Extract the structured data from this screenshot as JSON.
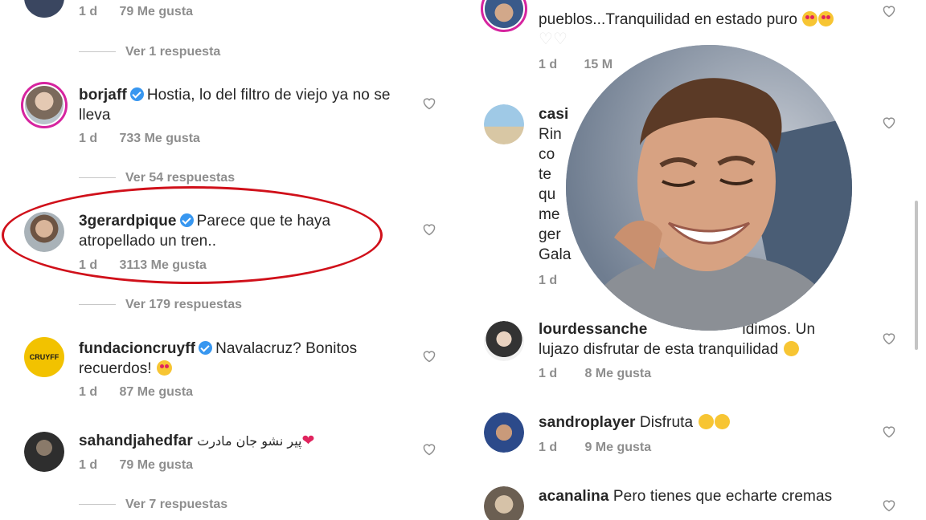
{
  "left_panel": {
    "top_comment": {
      "time": "1 d",
      "likes": "79 Me gusta",
      "replies": "Ver 1 respuesta"
    },
    "comments": [
      {
        "user": "borjaff",
        "verified": true,
        "text": "Hostia, lo del filtro de viejo ya no se lleva",
        "time": "1 d",
        "likes": "733 Me gusta",
        "replies": "Ver 54 respuestas"
      },
      {
        "user": "3gerardpique",
        "verified": true,
        "text": "Parece que te haya atropellado un tren..",
        "time": "1 d",
        "likes": "3113 Me gusta",
        "replies": "Ver 179 respuestas"
      },
      {
        "user": "fundacioncruyff",
        "verified": true,
        "text": "Navalacruz? Bonitos recuerdos!",
        "time": "1 d",
        "likes": "87 Me gusta"
      },
      {
        "user": "sahandjahedfar",
        "verified": false,
        "text": "پیر نشو جان مادرت",
        "time": "1 d",
        "likes": "79 Me gusta",
        "replies": "Ver 7 respuestas"
      }
    ]
  },
  "right_panel": {
    "comments": [
      {
        "text_line1": "pueblos...Tranquilidad en estado puro",
        "time": "1 d",
        "likes": "15 M"
      },
      {
        "user": "casi",
        "partial_lines": [
          "Rin",
          "co",
          "te",
          "qu",
          "me",
          "ger",
          "Gala"
        ],
        "time": "1 d"
      },
      {
        "user": "lourdessanche",
        "text_line1": "idimos. Un",
        "text_line2": "lujazo disfrutar de esta tranquilidad",
        "time": "1 d",
        "likes": "8 Me gusta"
      },
      {
        "user": "sandroplayer",
        "text": "Disfruta",
        "time": "1 d",
        "likes": "9 Me gusta"
      },
      {
        "user": "acanalina",
        "text": "Pero tienes que echarte cremas"
      }
    ]
  },
  "colors": {
    "highlight": "#d0101a",
    "verified": "#3897f0",
    "meta": "#8e8e8e"
  }
}
